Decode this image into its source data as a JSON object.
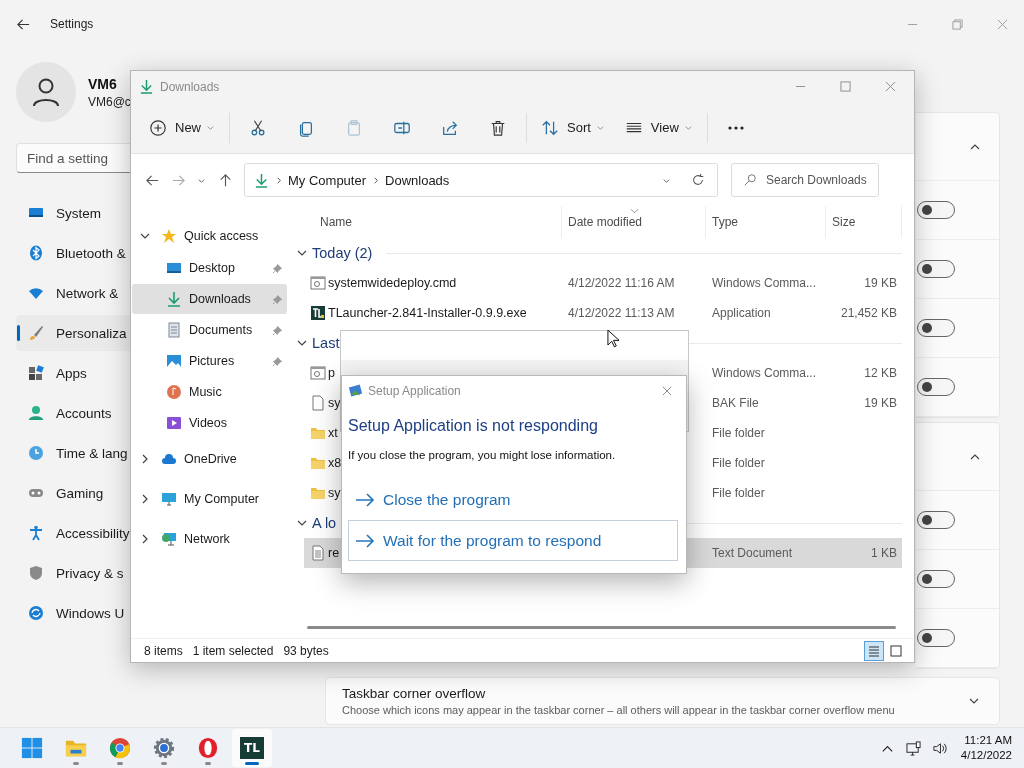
{
  "settings": {
    "title": "Settings",
    "user": {
      "name": "VM6",
      "email": "VM6@c"
    },
    "search": {
      "placeholder": "Find a setting"
    },
    "nav": [
      {
        "label": "System",
        "selected": false
      },
      {
        "label": "Bluetooth &",
        "selected": false
      },
      {
        "label": "Network &",
        "selected": false
      },
      {
        "label": "Personaliza",
        "selected": true
      },
      {
        "label": "Apps",
        "selected": false
      },
      {
        "label": "Accounts",
        "selected": false
      },
      {
        "label": "Time & lang",
        "selected": false
      },
      {
        "label": "Gaming",
        "selected": false
      },
      {
        "label": "Accessibility",
        "selected": false
      },
      {
        "label": "Privacy & s",
        "selected": false
      },
      {
        "label": "Windows U",
        "selected": false
      }
    ],
    "sections": [
      {
        "expanded": true,
        "toggles": [
          {
            "on": false
          },
          {
            "on": false
          },
          {
            "on": false
          },
          {
            "on": false
          }
        ]
      },
      {
        "expanded": true,
        "toggles": [
          {
            "on": false
          },
          {
            "on": false
          },
          {
            "on": false
          }
        ]
      },
      {
        "expanded": false,
        "title": "Taskbar corner overflow",
        "description": "Choose which icons may appear in the taskbar corner – all others will appear in the taskbar corner overflow menu"
      }
    ]
  },
  "explorer": {
    "title": "Downloads",
    "toolbar": [
      {
        "kind": "new",
        "label": "New",
        "disabled": false
      },
      {
        "kind": "cut",
        "disabled": false
      },
      {
        "kind": "copy",
        "disabled": false
      },
      {
        "kind": "paste",
        "disabled": true
      },
      {
        "kind": "rename",
        "disabled": false
      },
      {
        "kind": "share",
        "disabled": false
      },
      {
        "kind": "delete",
        "disabled": false
      },
      {
        "kind": "sort",
        "label": "Sort",
        "disabled": false
      },
      {
        "kind": "view",
        "label": "View",
        "disabled": false
      },
      {
        "kind": "more",
        "disabled": false
      }
    ],
    "breadcrumbs": [
      "My Computer",
      "Downloads"
    ],
    "search": {
      "placeholder": "Search Downloads"
    },
    "nav_pane": [
      {
        "label": "Quick access",
        "expanded": true,
        "selected": false,
        "children": [
          {
            "label": "Desktop",
            "pinned": true,
            "selected": false
          },
          {
            "label": "Downloads",
            "pinned": true,
            "selected": true
          },
          {
            "label": "Documents",
            "pinned": true,
            "selected": false
          },
          {
            "label": "Pictures",
            "pinned": true,
            "selected": false
          },
          {
            "label": "Music",
            "pinned": false,
            "selected": false
          },
          {
            "label": "Videos",
            "pinned": false,
            "selected": false
          }
        ]
      },
      {
        "label": "OneDrive",
        "expanded": false,
        "selected": false
      },
      {
        "label": "My Computer",
        "expanded": false,
        "selected": false
      },
      {
        "label": "Network",
        "expanded": false,
        "selected": false
      }
    ],
    "columns": [
      {
        "label": "Name",
        "sorted": false
      },
      {
        "label": "Date modified",
        "sorted": true
      },
      {
        "label": "Type",
        "sorted": false
      },
      {
        "label": "Size",
        "sorted": false
      }
    ],
    "groups": [
      {
        "title": "Today (2)",
        "expanded": true,
        "files": [
          {
            "kind": "script",
            "name": "systemwidedeploy.cmd",
            "date": "4/12/2022 11:16 AM",
            "type": "Windows Comma...",
            "size": "19 KB",
            "selected": false
          },
          {
            "kind": "app",
            "name": "TLauncher-2.841-Installer-0.9.9.exe",
            "date": "4/12/2022 11:13 AM",
            "type": "Application",
            "size": "21,452 KB",
            "selected": false
          }
        ]
      },
      {
        "title": "Last",
        "expanded": true,
        "files": [
          {
            "kind": "script",
            "name": "p",
            "type": "Windows Comma...",
            "size": "12 KB",
            "selected": false
          },
          {
            "kind": "file",
            "name": "sy",
            "type": "BAK File",
            "size": "19 KB",
            "selected": false
          },
          {
            "kind": "folder",
            "name": "xt",
            "type": "File folder",
            "selected": false
          },
          {
            "kind": "folder",
            "name": "x8",
            "type": "File folder",
            "selected": false
          },
          {
            "kind": "folder",
            "name": "sy",
            "type": "File folder",
            "selected": false
          }
        ]
      },
      {
        "title": "A lo",
        "expanded": true,
        "files": [
          {
            "kind": "text",
            "name": "re",
            "type": "Text Document",
            "size": "1 KB",
            "selected": true
          }
        ]
      }
    ],
    "status": {
      "count": "8 items",
      "selection": "1 item selected",
      "bytes": "93 bytes"
    },
    "views": [
      {
        "kind": "details",
        "selected": true
      },
      {
        "kind": "tiles",
        "selected": false
      }
    ]
  },
  "dialog": {
    "title": "Setup Application",
    "heading": "Setup Application is not responding",
    "message": "If you close the program, you might lose information.",
    "options": [
      {
        "label": "Close the program",
        "focused": false
      },
      {
        "label": "Wait for the program to respond",
        "focused": true
      }
    ]
  },
  "taskbar": {
    "apps": [
      {
        "running": false,
        "selected": false
      },
      {
        "running": true,
        "selected": false
      },
      {
        "running": true,
        "selected": false
      },
      {
        "running": true,
        "selected": false
      },
      {
        "running": true,
        "selected": false
      },
      {
        "running": true,
        "selected": true,
        "label": "TL"
      }
    ],
    "time": "11:21 AM",
    "date": "4/12/2022"
  }
}
